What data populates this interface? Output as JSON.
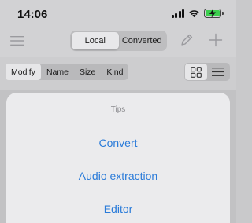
{
  "status_bar": {
    "time": "14:06"
  },
  "toolbar": {
    "segments": [
      {
        "label": "Local",
        "active": true
      },
      {
        "label": "Converted",
        "active": false
      }
    ]
  },
  "sort_bar": {
    "items": [
      "Modify",
      "Name",
      "Size",
      "Kind"
    ],
    "active": "Modify",
    "view_active": "grid"
  },
  "sheet": {
    "title": "Tips",
    "actions": [
      "Convert",
      "Audio extraction",
      "Editor"
    ]
  },
  "colors": {
    "accent": "#2a7bd9",
    "battery": "#3ccf4e"
  }
}
